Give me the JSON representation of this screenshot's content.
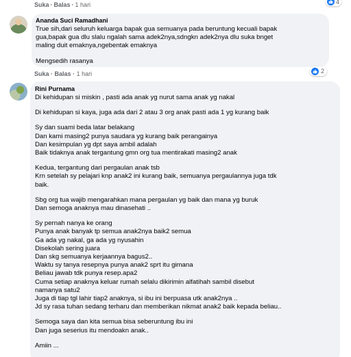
{
  "prev_comment": {
    "like": "Suka",
    "reply": "Balas",
    "time": "1 hari",
    "reaction_count": "4"
  },
  "comment1": {
    "author": "Ananda Suci Ramadhani",
    "lines": [
      "True sih,dari seluruh keluarga bapak gua semuanya pada beruntung kecuali bapak",
      "gua,bapak gua dlu slalu ngalah sama adek2nya,sdngkn adek2nya dlu suka bnget",
      "maling duit emaknya,ngebentak emaknya",
      "",
      "Mengsedih rasanya"
    ],
    "like": "Suka",
    "reply": "Balas",
    "time": "1 hari",
    "reaction_count": "2"
  },
  "comment2": {
    "author": "Rini Purnama",
    "lines": [
      "Di kehidupan si miskin , pasti ada anak yg nurut sama anak yg nakal",
      "",
      "Di kehidupan si kaya, juga ada dari 2 atau 3 org anak pasti ada 1 yg kurang baik",
      "",
      "Sy dan suami beda latar belakang",
      "Dan kami masing2 punya saudara yg kurang baik perangainya",
      "Dan kesimpulan yg dpt saya ambil adalah",
      "Baik tidaknya anak tergantung gmn org tua mentirakati masing2 anak",
      "",
      "Kedua, tergantung dari pergaulan anak tsb",
      "Krn setelah sy pelajari knp anak2 ini kurang baik, semuanya pergaulannya juga tdk",
      "baik.",
      "",
      "Sbg org tua wajib mengarahkan mana pergaulan yg baik dan mana yg buruk",
      "Dan semoga anaknya mau dinasehati ..",
      "",
      "Sy pernah nanya ke orang",
      "Punya anak banyak tp semua anak2nya baik2 semua",
      "Ga ada yg nakal, ga ada yg nyusahin",
      "Disekolah sering juara",
      "Dan skg semuanya kerjaannya bagus2..",
      "Waktu sy tanya resepnya punya anak2 sprt itu gimana",
      "Beliau jawab tdk punya resep.apa2",
      "Cuma setiap anaknya keluar rumah selalu dikirimin alfatihah sambil disebut",
      "namanya satu2",
      "Juga di tiap tgl lahir tiap2 anaknya, si ibu ini berpuasa utk anak2nya ..",
      "Jd sy rasa tuhan sedang terharu dan memberikan nikmat anak2 baik kepada beliau..",
      "",
      "Semoga saya dan kita semua bisa seberuntung ibu ini",
      "Dan juga seserius itu mendoakn anak..",
      "",
      "Amiin ..."
    ]
  },
  "colors": {
    "bubble": "#f0f2f5",
    "meta_text": "#65676b",
    "like_blue": "#1877f2"
  }
}
